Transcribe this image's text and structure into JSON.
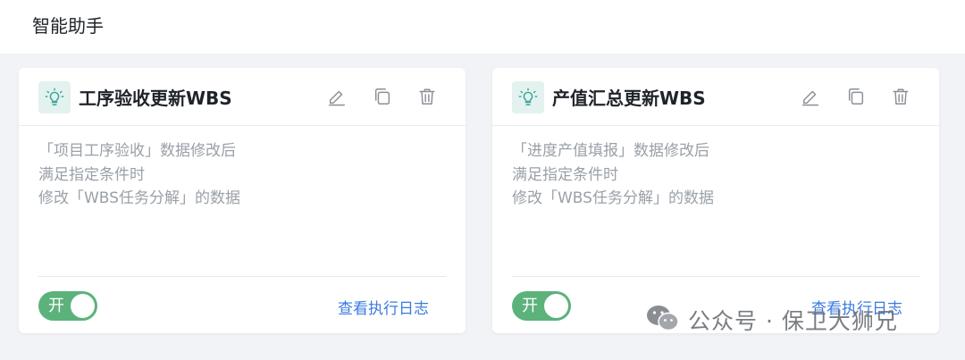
{
  "header": {
    "title": "智能助手"
  },
  "cards": [
    {
      "title": "工序验收更新WBS",
      "description": [
        "「项目工序验收」数据修改后",
        "满足指定条件时",
        "修改「WBS任务分解」的数据"
      ],
      "toggle": {
        "label": "开",
        "on": true
      },
      "log_link": "查看执行日志",
      "icons": {
        "bulb": "lightbulb-icon",
        "edit": "edit-icon",
        "copy": "copy-icon",
        "delete": "delete-icon"
      }
    },
    {
      "title": "产值汇总更新WBS",
      "description": [
        "「进度产值填报」数据修改后",
        "满足指定条件时",
        "修改「WBS任务分解」的数据"
      ],
      "toggle": {
        "label": "开",
        "on": true
      },
      "log_link": "查看执行日志",
      "icons": {
        "bulb": "lightbulb-icon",
        "edit": "edit-icon",
        "copy": "copy-icon",
        "delete": "delete-icon"
      }
    }
  ],
  "watermark": {
    "text": "公众号 · 保卫大狮兄",
    "icon": "wechat-icon"
  },
  "colors": {
    "accent_green": "#5cb27b",
    "link_blue": "#3b7be0",
    "bulb_bg": "#e3f2ef",
    "bulb_color": "#3aa597"
  }
}
